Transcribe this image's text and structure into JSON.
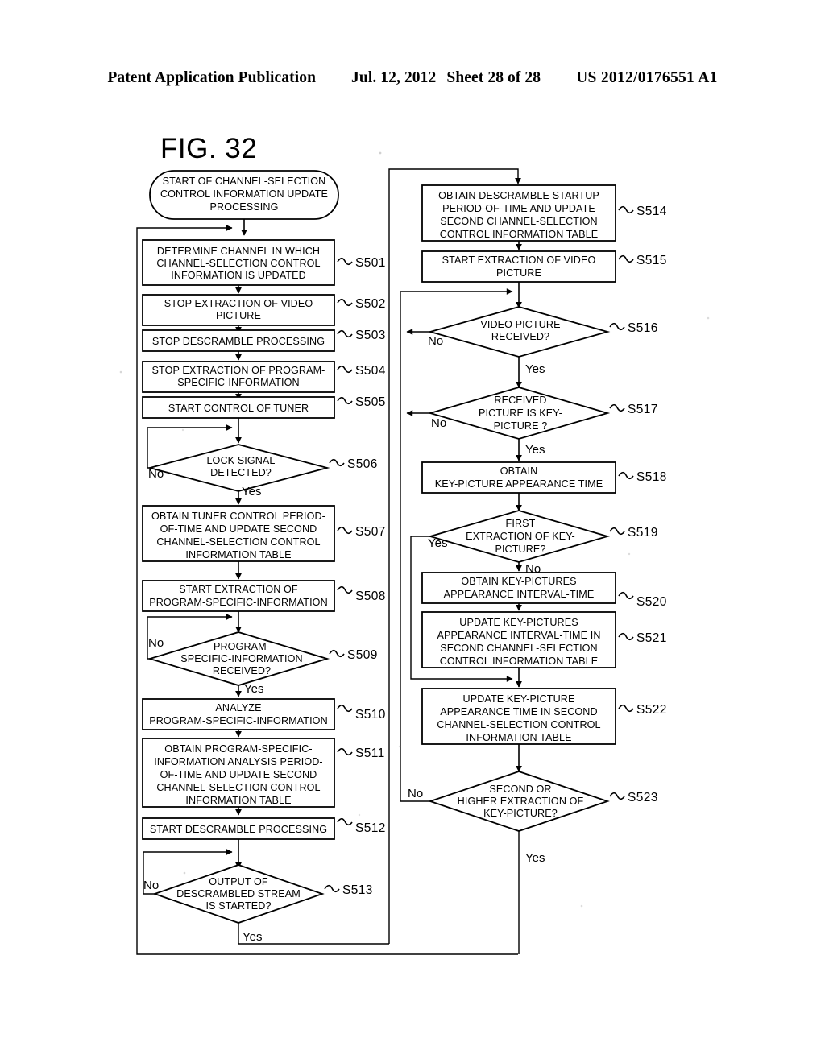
{
  "header": {
    "publication": "Patent Application Publication",
    "date": "Jul. 12, 2012",
    "sheet": "Sheet 28 of 28",
    "number": "US 2012/0176551 A1"
  },
  "figure": {
    "title": "FIG. 32"
  },
  "flowchart": {
    "start": {
      "id": "start",
      "type": "terminator",
      "text": "START OF CHANNEL-SELECTION CONTROL INFORMATION UPDATE PROCESSING",
      "lines": [
        "START OF CHANNEL-SELECTION",
        "CONTROL INFORMATION UPDATE",
        "PROCESSING"
      ]
    },
    "steps": [
      {
        "id": "S501",
        "label": "S501",
        "type": "process",
        "lines": [
          "DETERMINE CHANNEL IN WHICH",
          "CHANNEL-SELECTION CONTROL",
          "INFORMATION IS UPDATED"
        ]
      },
      {
        "id": "S502",
        "label": "S502",
        "type": "process",
        "lines": [
          "STOP EXTRACTION OF VIDEO",
          "PICTURE"
        ]
      },
      {
        "id": "S503",
        "label": "S503",
        "type": "process",
        "lines": [
          "STOP DESCRAMBLE PROCESSING"
        ]
      },
      {
        "id": "S504",
        "label": "S504",
        "type": "process",
        "lines": [
          "STOP EXTRACTION OF PROGRAM-",
          "SPECIFIC-INFORMATION"
        ]
      },
      {
        "id": "S505",
        "label": "S505",
        "type": "process",
        "lines": [
          "START CONTROL OF TUNER"
        ]
      },
      {
        "id": "S506",
        "label": "S506",
        "type": "decision",
        "lines": [
          "LOCK SIGNAL",
          "DETECTED?"
        ],
        "yes": "Yes",
        "no": "No"
      },
      {
        "id": "S507",
        "label": "S507",
        "type": "process",
        "lines": [
          "OBTAIN TUNER CONTROL PERIOD-",
          "OF-TIME AND UPDATE SECOND",
          "CHANNEL-SELECTION CONTROL",
          "INFORMATION TABLE"
        ]
      },
      {
        "id": "S508",
        "label": "S508",
        "type": "process",
        "lines": [
          "START EXTRACTION OF",
          "PROGRAM-SPECIFIC-INFORMATION"
        ]
      },
      {
        "id": "S509",
        "label": "S509",
        "type": "decision",
        "lines": [
          "PROGRAM-",
          "SPECIFIC-INFORMATION",
          "RECEIVED?"
        ],
        "yes": "Yes",
        "no": "No"
      },
      {
        "id": "S510",
        "label": "S510",
        "type": "process",
        "lines": [
          "ANALYZE",
          "PROGRAM-SPECIFIC-INFORMATION"
        ]
      },
      {
        "id": "S511",
        "label": "S511",
        "type": "process",
        "lines": [
          "OBTAIN PROGRAM-SPECIFIC-",
          "INFORMATION ANALYSIS PERIOD-",
          "OF-TIME AND UPDATE SECOND",
          "CHANNEL-SELECTION CONTROL",
          "INFORMATION TABLE"
        ]
      },
      {
        "id": "S512",
        "label": "S512",
        "type": "process",
        "lines": [
          "START DESCRAMBLE PROCESSING"
        ]
      },
      {
        "id": "S513",
        "label": "S513",
        "type": "decision",
        "lines": [
          "OUTPUT OF",
          "DESCRAMBLED STREAM",
          "IS STARTED?"
        ],
        "yes": "Yes",
        "no": "No"
      },
      {
        "id": "S514",
        "label": "S514",
        "type": "process",
        "lines": [
          "OBTAIN DESCRAMBLE STARTUP",
          "PERIOD-OF-TIME AND UPDATE",
          "SECOND CHANNEL-SELECTION",
          "CONTROL INFORMATION TABLE"
        ]
      },
      {
        "id": "S515",
        "label": "S515",
        "type": "process",
        "lines": [
          "START EXTRACTION OF VIDEO",
          "PICTURE"
        ]
      },
      {
        "id": "S516",
        "label": "S516",
        "type": "decision",
        "lines": [
          "VIDEO PICTURE",
          "RECEIVED?"
        ],
        "yes": "Yes",
        "no": "No"
      },
      {
        "id": "S517",
        "label": "S517",
        "type": "decision",
        "lines": [
          "RECEIVED",
          "PICTURE IS KEY-",
          "PICTURE ?"
        ],
        "yes": "Yes",
        "no": "No"
      },
      {
        "id": "S518",
        "label": "S518",
        "type": "process",
        "lines": [
          "OBTAIN",
          "KEY-PICTURE APPEARANCE TIME"
        ]
      },
      {
        "id": "S519",
        "label": "S519",
        "type": "decision",
        "lines": [
          "FIRST",
          "EXTRACTION OF KEY-",
          "PICTURE?"
        ],
        "yes": "Yes",
        "no": "No"
      },
      {
        "id": "S520",
        "label": "S520",
        "type": "process",
        "lines": [
          "OBTAIN KEY-PICTURES",
          "APPEARANCE INTERVAL-TIME"
        ]
      },
      {
        "id": "S521",
        "label": "S521",
        "type": "process",
        "lines": [
          "UPDATE KEY-PICTURES",
          "APPEARANCE INTERVAL-TIME IN",
          "SECOND CHANNEL-SELECTION",
          "CONTROL INFORMATION TABLE"
        ]
      },
      {
        "id": "S522",
        "label": "S522",
        "type": "process",
        "lines": [
          "UPDATE KEY-PICTURE",
          "APPEARANCE TIME IN SECOND",
          "CHANNEL-SELECTION CONTROL",
          "INFORMATION TABLE"
        ]
      },
      {
        "id": "S523",
        "label": "S523",
        "type": "decision",
        "lines": [
          "SECOND OR",
          "HIGHER EXTRACTION OF",
          "KEY-PICTURE?"
        ],
        "yes": "Yes",
        "no": "No"
      }
    ]
  }
}
